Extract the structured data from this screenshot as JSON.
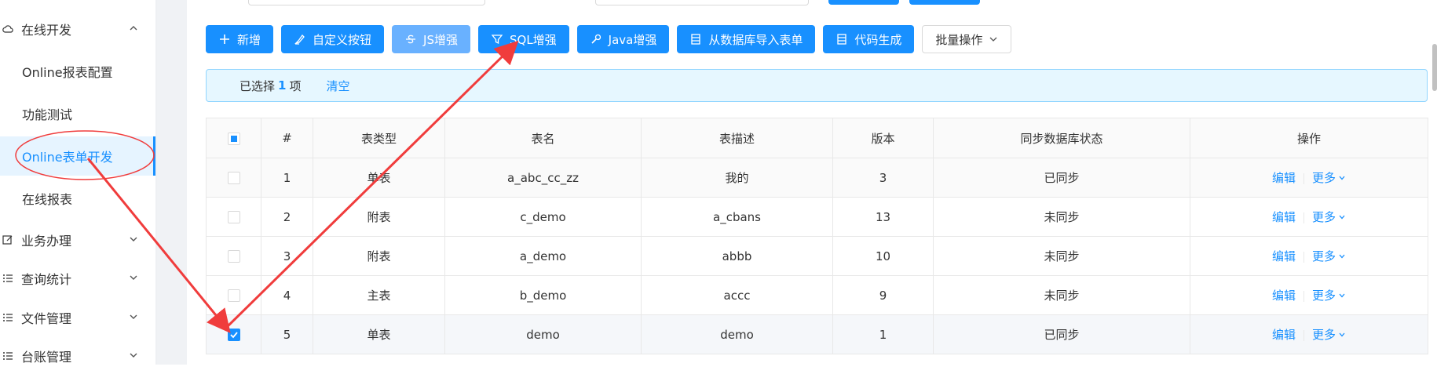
{
  "sidebar": {
    "group_online": "在线开发",
    "items": [
      {
        "label": "Online报表配置"
      },
      {
        "label": "功能测试"
      },
      {
        "label": "Online表单开发"
      },
      {
        "label": "在线报表"
      }
    ],
    "groups": [
      {
        "label": "业务办理",
        "icon": "edit-icon"
      },
      {
        "label": "查询统计",
        "icon": "list-icon"
      },
      {
        "label": "文件管理",
        "icon": "list-icon"
      },
      {
        "label": "台账管理",
        "icon": "list-icon"
      }
    ]
  },
  "toolbar": {
    "add": "新增",
    "custom_button": "自定义按钮",
    "js_enhance": "JS增强",
    "sql_enhance": "SQL增强",
    "java_enhance": "Java增强",
    "import_from_db": "从数据库导入表单",
    "code_gen": "代码生成",
    "batch": "批量操作"
  },
  "alert": {
    "selected_prefix": "已选择",
    "selected_count": "1",
    "selected_suffix": "项",
    "clear": "清空"
  },
  "table": {
    "headers": [
      "#",
      "表类型",
      "表名",
      "表描述",
      "版本",
      "同步数据库状态",
      "操作"
    ],
    "rows": [
      {
        "no": "1",
        "type": "单表",
        "name": "a_abc_cc_zz",
        "desc": "我的",
        "version": "3",
        "status": "已同步",
        "ok": true,
        "checked": false
      },
      {
        "no": "2",
        "type": "附表",
        "name": "c_demo",
        "desc": "a_cbans",
        "version": "13",
        "status": "未同步",
        "ok": false,
        "checked": false
      },
      {
        "no": "3",
        "type": "附表",
        "name": "a_demo",
        "desc": "abbb",
        "version": "10",
        "status": "未同步",
        "ok": false,
        "checked": false
      },
      {
        "no": "4",
        "type": "主表",
        "name": "b_demo",
        "desc": "accc",
        "version": "9",
        "status": "未同步",
        "ok": false,
        "checked": false
      },
      {
        "no": "5",
        "type": "单表",
        "name": "demo",
        "desc": "demo",
        "version": "1",
        "status": "已同步",
        "ok": true,
        "checked": true
      }
    ],
    "op_edit": "编辑",
    "op_more": "更多"
  },
  "colors": {
    "primary": "#1890ff",
    "synced": "#52c41a",
    "unsynced": "#f5222d",
    "annotation": "#f03c3c"
  }
}
